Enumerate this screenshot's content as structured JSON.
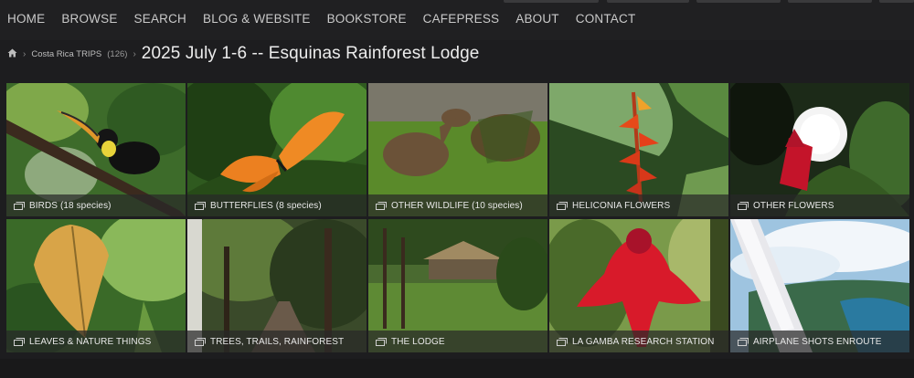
{
  "nav": {
    "items": [
      {
        "label": "HOME"
      },
      {
        "label": "BROWSE"
      },
      {
        "label": "SEARCH"
      },
      {
        "label": "BLOG & WEBSITE"
      },
      {
        "label": "BOOKSTORE"
      },
      {
        "label": "CAFEPRESS"
      },
      {
        "label": "ABOUT"
      },
      {
        "label": "CONTACT"
      }
    ]
  },
  "breadcrumb": {
    "home_icon": "home-icon",
    "parent_label": "Costa Rica TRIPS",
    "parent_count": "(126)",
    "separator": "›"
  },
  "page": {
    "title": "2025 July 1-6 -- Esquinas Rainforest Lodge"
  },
  "galleries": [
    {
      "label": "BIRDS (18 species)"
    },
    {
      "label": "BUTTERFLIES (8 species)"
    },
    {
      "label": "OTHER WILDLIFE (10 species)"
    },
    {
      "label": "HELICONIA FLOWERS"
    },
    {
      "label": "OTHER FLOWERS"
    },
    {
      "label": "LEAVES & NATURE THINGS"
    },
    {
      "label": "TREES, TRAILS, RAINFOREST"
    },
    {
      "label": "THE LODGE"
    },
    {
      "label": "LA GAMBA RESEARCH STATION"
    },
    {
      "label": "AIRPLANE SHOTS ENROUTE"
    }
  ],
  "colors": {
    "background": "#1d1d1f",
    "nav_text": "#c9c9c9",
    "caption_bg": "#2a2a2a"
  }
}
